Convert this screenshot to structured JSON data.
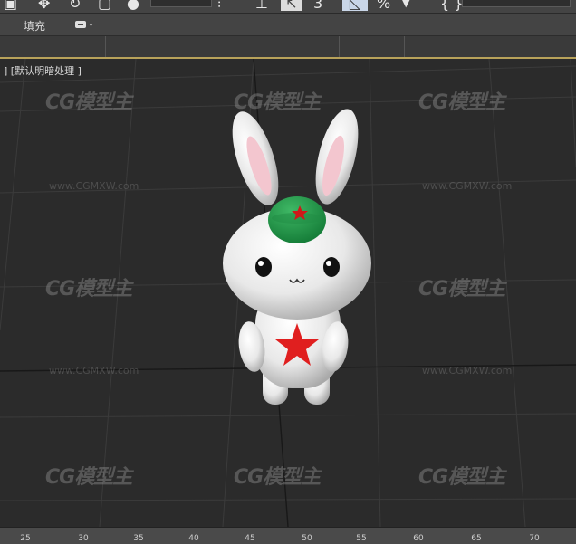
{
  "ribbon": {
    "fill_label": "填充"
  },
  "viewport": {
    "label": "] [默认明暗处理 ]"
  },
  "watermark": {
    "logo_text": "CG模型主",
    "url": "www.CGMXW.com"
  },
  "timeline_ruler": {
    "ticks": [
      "25",
      "30",
      "35",
      "40",
      "45",
      "50",
      "55",
      "60",
      "65",
      "70"
    ]
  },
  "colors": {
    "viewport_border": "#b8a25a",
    "background": "#2b2b2b",
    "cap": "#2e9a4e",
    "star": "#e01f1f"
  },
  "icons": [
    "select-icon",
    "move-icon",
    "rotate-icon",
    "scale-icon",
    "snap-icon",
    "percent-snap-icon",
    "curly-brace-icon",
    "dropdown-arrow-icon"
  ]
}
